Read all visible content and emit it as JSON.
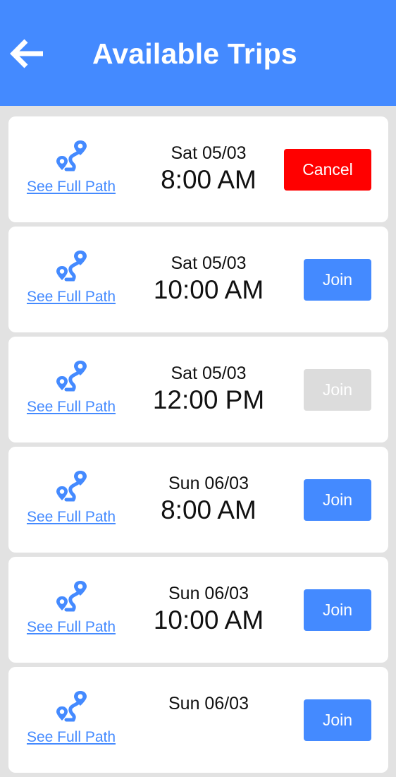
{
  "header": {
    "title": "Available Trips",
    "back_icon": "arrow-left-icon",
    "background": "#448aff"
  },
  "colors": {
    "accent": "#448aff",
    "cancel": "#ff0000",
    "disabled": "#dcdcdc"
  },
  "trips": [
    {
      "path_icon": "route-icon",
      "path_label": "See Full Path",
      "date": "Sat 05/03",
      "time": "8:00 AM",
      "action": "Cancel",
      "action_state": "cancel"
    },
    {
      "path_icon": "route-icon",
      "path_label": "See Full Path",
      "date": "Sat 05/03",
      "time": "10:00 AM",
      "action": "Join",
      "action_state": "join"
    },
    {
      "path_icon": "route-icon",
      "path_label": "See Full Path",
      "date": "Sat 05/03",
      "time": "12:00 PM",
      "action": "Join",
      "action_state": "disabled"
    },
    {
      "path_icon": "route-icon",
      "path_label": "See Full Path",
      "date": "Sun 06/03",
      "time": "8:00 AM",
      "action": "Join",
      "action_state": "join"
    },
    {
      "path_icon": "route-icon",
      "path_label": "See Full Path",
      "date": "Sun 06/03",
      "time": "10:00 AM",
      "action": "Join",
      "action_state": "join"
    },
    {
      "path_icon": "route-icon",
      "path_label": "See Full Path",
      "date": "Sun 06/03",
      "time": "",
      "action": "Join",
      "action_state": "join"
    }
  ]
}
